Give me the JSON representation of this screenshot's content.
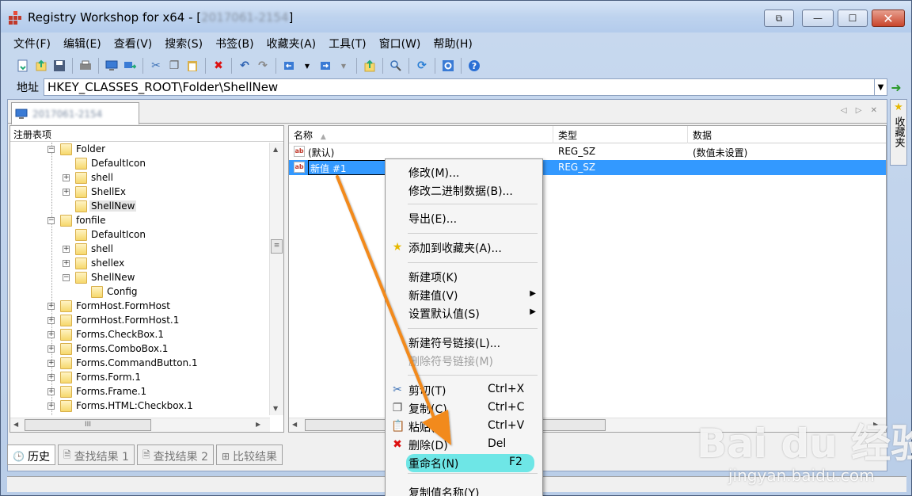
{
  "window": {
    "title": "Registry Workshop for x64 - [",
    "title_blurred": "2017061-2154",
    "title_end": "]",
    "btn_restore": "⧉",
    "btn_minimize": "—",
    "btn_maximize": "☐",
    "btn_close": "✕"
  },
  "menubar": [
    "文件(F)",
    "编辑(E)",
    "查看(V)",
    "搜索(S)",
    "书签(B)",
    "收藏夹(A)",
    "工具(T)",
    "窗口(W)",
    "帮助(H)"
  ],
  "address": {
    "label": "地址",
    "value": "HKEY_CLASSES_ROOT\\Folder\\ShellNew"
  },
  "computer_tab": {
    "label_blurred": "2017061-2154"
  },
  "tree": {
    "header": "注册表项",
    "items": [
      {
        "label": "Folder",
        "level": 0,
        "expander": "−"
      },
      {
        "label": "DefaultIcon",
        "level": 1,
        "expander": ""
      },
      {
        "label": "shell",
        "level": 1,
        "expander": "+"
      },
      {
        "label": "ShellEx",
        "level": 1,
        "expander": "+"
      },
      {
        "label": "ShellNew",
        "level": 1,
        "expander": "",
        "selected": true
      },
      {
        "label": "fonfile",
        "level": 0,
        "expander": "−"
      },
      {
        "label": "DefaultIcon",
        "level": 1,
        "expander": ""
      },
      {
        "label": "shell",
        "level": 1,
        "expander": "+"
      },
      {
        "label": "shellex",
        "level": 1,
        "expander": "+"
      },
      {
        "label": "ShellNew",
        "level": 1,
        "expander": "−"
      },
      {
        "label": "Config",
        "level": 2,
        "expander": ""
      },
      {
        "label": "FormHost.FormHost",
        "level": 0,
        "expander": "+"
      },
      {
        "label": "FormHost.FormHost.1",
        "level": 0,
        "expander": "+"
      },
      {
        "label": "Forms.CheckBox.1",
        "level": 0,
        "expander": "+"
      },
      {
        "label": "Forms.ComboBox.1",
        "level": 0,
        "expander": "+"
      },
      {
        "label": "Forms.CommandButton.1",
        "level": 0,
        "expander": "+"
      },
      {
        "label": "Forms.Form.1",
        "level": 0,
        "expander": "+"
      },
      {
        "label": "Forms.Frame.1",
        "level": 0,
        "expander": "+"
      },
      {
        "label": "Forms.HTML:Checkbox.1",
        "level": 0,
        "expander": "+"
      }
    ]
  },
  "list": {
    "columns": [
      "名称",
      "类型",
      "数据"
    ],
    "rows": [
      {
        "name": "(默认)",
        "type": "REG_SZ",
        "data": "(数值未设置)"
      },
      {
        "name": "新值 #1",
        "type": "REG_SZ",
        "data": ""
      }
    ]
  },
  "context_menu": {
    "items": [
      {
        "label": "修改(M)...",
        "shortcut": "",
        "icon": ""
      },
      {
        "label": "修改二进制数据(B)...",
        "shortcut": "",
        "icon": ""
      },
      {
        "label": "导出(E)...",
        "shortcut": "",
        "icon": ""
      },
      {
        "label": "添加到收藏夹(A)...",
        "shortcut": "",
        "icon": "star-icon"
      },
      {
        "label": "新建项(K)",
        "shortcut": "",
        "icon": ""
      },
      {
        "label": "新建值(V)",
        "shortcut": "",
        "icon": "",
        "submenu": true
      },
      {
        "label": "设置默认值(S)",
        "shortcut": "",
        "icon": "",
        "submenu": true
      },
      {
        "label": "新建符号链接(L)...",
        "shortcut": "",
        "icon": ""
      },
      {
        "label": "删除符号链接(M)",
        "shortcut": "",
        "icon": "",
        "disabled": true
      },
      {
        "label": "剪切(T)",
        "shortcut": "Ctrl+X",
        "icon": "scissors-icon"
      },
      {
        "label": "复制(C)",
        "shortcut": "Ctrl+C",
        "icon": "copy-icon"
      },
      {
        "label": "粘贴(P)",
        "shortcut": "Ctrl+V",
        "icon": "paste-icon"
      },
      {
        "label": "删除(D)",
        "shortcut": "Del",
        "icon": "delete-icon"
      },
      {
        "label": "重命名(N)",
        "shortcut": "F2",
        "icon": "",
        "highlighted": true
      },
      {
        "label": "复制值名称(Y)",
        "shortcut": "",
        "icon": ""
      }
    ],
    "glyphs": {
      "star": "★",
      "scissors": "✂",
      "copy": "❐",
      "paste": "📋",
      "delete": "✖",
      "submenu": "▶"
    }
  },
  "bottom_tabs": [
    "历史",
    "查找结果 1",
    "查找结果 2",
    "比较结果"
  ],
  "favorites_strip": {
    "label": "收藏夹",
    "icon": "★"
  },
  "watermark": {
    "logo": "Bai du 经验",
    "url": "jingyan.baidu.com"
  },
  "colors": {
    "selection": "#3399ff",
    "menu_highlight": "#6ee6e6",
    "arrow": "#f28a1c"
  }
}
